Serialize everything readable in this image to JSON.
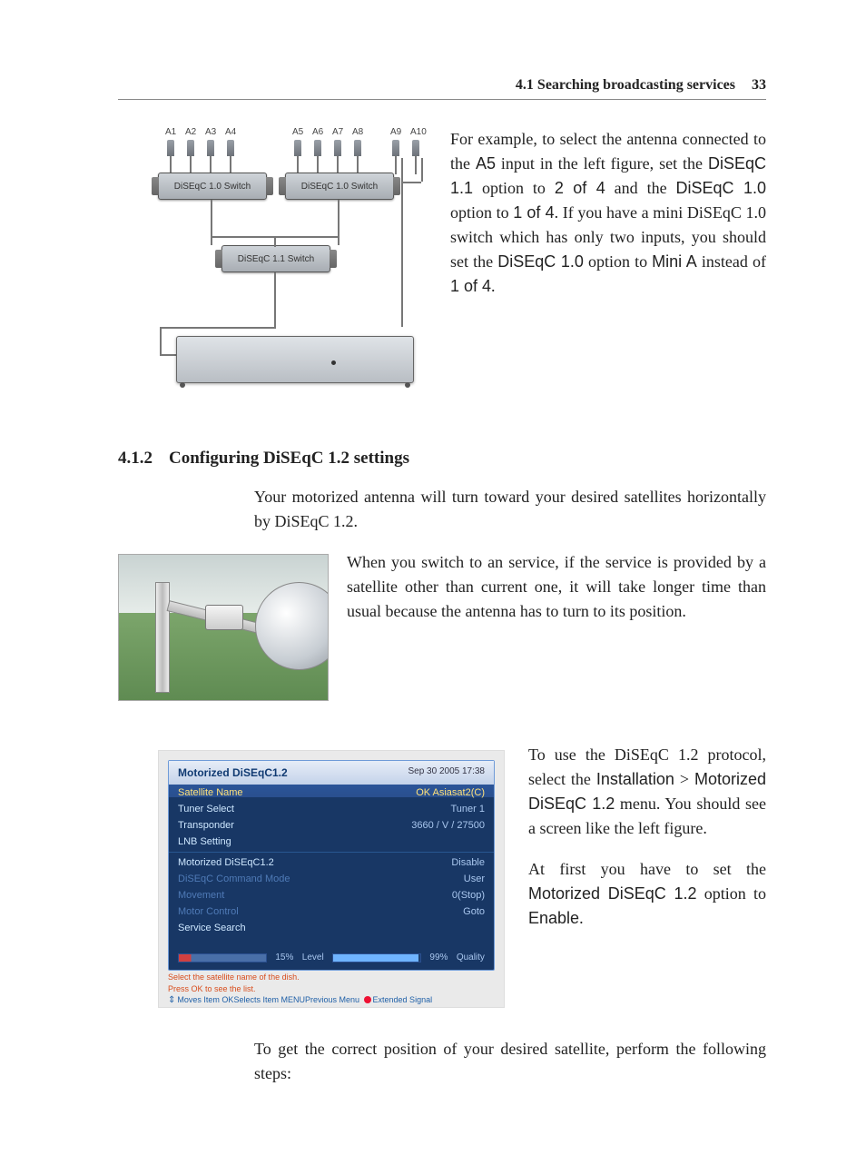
{
  "header": {
    "section": "4.1 Searching broadcasting services",
    "page_number": "33"
  },
  "subheading_412": {
    "number": "4.1.2",
    "title": "Configuring DiSEqC 1.2 settings"
  },
  "diagram": {
    "labels": {
      "a1": "A1",
      "a2": "A2",
      "a3": "A3",
      "a4": "A4",
      "a5": "A5",
      "a6": "A6",
      "a7": "A7",
      "a8": "A8",
      "a9": "A9",
      "a10": "A10"
    },
    "switch10_label": "DiSEqC 1.0 Switch",
    "switch11_label": "DiSEqC 1.1 Switch"
  },
  "paragraph1": {
    "p1a": "For example, to select the antenna connected to the ",
    "a5": "A5",
    "p1b": " input in the left figure, set the ",
    "opt11": "DiSEqC 1.1",
    "p1c": " option to ",
    "v2of4": "2 of 4",
    "p1d": " and the ",
    "opt10": "DiSEqC 1.0",
    "p1e": " option to ",
    "v1of4": "1 of 4",
    "p1f": ". If you have a mini DiSEqC 1.0 switch which has only two inputs, you should set the ",
    "opt10b": "DiSEqC 1.0",
    "p1g": " option to ",
    "miniA": "Mini A",
    "p1h": " instead of ",
    "v1of4b": "1 of 4",
    "p1i": "."
  },
  "paragraph2": "Your motorized antenna will turn toward your desired satellites horizontally by DiSEqC 1.2.",
  "paragraph3": "When you switch to an service, if the service is provided by a satellite other than current one, it will take longer time than usual because the antenna has to turn to its position.",
  "paragraph4": {
    "a": "To use the DiSEqC 1.2 protocol, select the ",
    "menu1": "Installation",
    "gt": " > ",
    "menu2": "Motorized DiSEqC 1.2",
    "b": " menu. You should see a screen like the left figure."
  },
  "paragraph5": {
    "a": "At first you have to set the ",
    "opt": "Motorized DiSEqC 1.2",
    "b": " option to ",
    "val": "Enable",
    "c": "."
  },
  "paragraph6": "To get the correct position of your desired satellite, perform the following steps:",
  "osd": {
    "title": "Motorized DiSEqC1.2",
    "datetime": "Sep 30 2005 17:38",
    "rows": {
      "sat_name": {
        "label": "Satellite Name",
        "value": "OK Asiasat2(C)"
      },
      "tuner": {
        "label": "Tuner Select",
        "value": "Tuner 1"
      },
      "tp": {
        "label": "Transponder",
        "value": "3660 / V / 27500"
      },
      "lnb": {
        "label": "LNB Setting",
        "value": ""
      },
      "motorized": {
        "label": "Motorized DiSEqC1.2",
        "value": "Disable"
      },
      "cmd": {
        "label": "DiSEqC Command Mode",
        "value": "User"
      },
      "movement": {
        "label": "Movement",
        "value": "0(Stop)"
      },
      "control": {
        "label": "Motor Control",
        "value": "Goto"
      },
      "search": {
        "label": "Service Search",
        "value": ""
      }
    },
    "level_pct": "15%",
    "level_label": "Level",
    "quality_pct": "99%",
    "quality_label": "Quality",
    "help_line1": "Select the satellite name of the dish.",
    "help_line2": "Press OK to see the list.",
    "help_moves": "Moves Item",
    "help_ok": "OK",
    "help_selects": "Selects Item",
    "help_menu": "MENU",
    "help_prev": "Previous Menu",
    "help_ext": "Extended Signal"
  }
}
